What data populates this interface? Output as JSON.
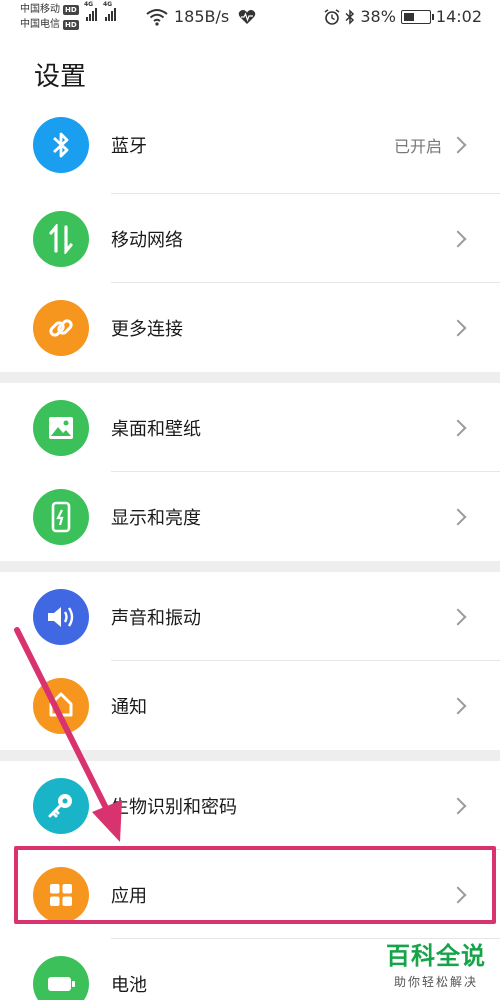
{
  "status_bar": {
    "carrier1": "中国移动",
    "carrier2": "中国电信",
    "hd_label": "HD",
    "network": "4G",
    "speed": "185B/s",
    "battery": "38%",
    "battery_level": 0.38,
    "time": "14:02"
  },
  "header": {
    "title": "设置"
  },
  "sections": [
    {
      "items": [
        {
          "label": "蓝牙",
          "value": "已开启",
          "icon": "bluetooth-icon",
          "color": "#1a9ef0"
        },
        {
          "label": "移动网络",
          "value": "",
          "icon": "mobile-data-icon",
          "color": "#3cc15a"
        },
        {
          "label": "更多连接",
          "value": "",
          "icon": "link-icon",
          "color": "#f6961e"
        }
      ]
    },
    {
      "items": [
        {
          "label": "桌面和壁纸",
          "value": "",
          "icon": "wallpaper-icon",
          "color": "#3cc15a"
        },
        {
          "label": "显示和亮度",
          "value": "",
          "icon": "display-icon",
          "color": "#3cc15a"
        }
      ]
    },
    {
      "items": [
        {
          "label": "声音和振动",
          "value": "",
          "icon": "sound-icon",
          "color": "#4168e3"
        },
        {
          "label": "通知",
          "value": "",
          "icon": "notification-icon",
          "color": "#f6961e"
        }
      ]
    },
    {
      "items": [
        {
          "label": "生物识别和密码",
          "value": "",
          "icon": "key-icon",
          "color": "#1ab4c8"
        },
        {
          "label": "应用",
          "value": "",
          "icon": "apps-icon",
          "color": "#f6961e"
        },
        {
          "label": "电池",
          "value": "",
          "icon": "battery-icon",
          "color": "#3cc15a"
        }
      ]
    }
  ],
  "annotation": {
    "color": "#d8336f"
  },
  "watermark": {
    "title": "百科全说",
    "subtitle": "助你轻松解决"
  }
}
